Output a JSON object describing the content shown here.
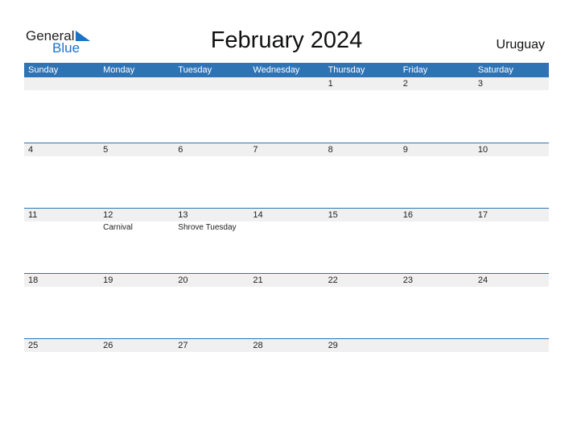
{
  "logo": {
    "word1": "General",
    "word2": "Blue"
  },
  "title": "February 2024",
  "country": "Uruguay",
  "weekdays": [
    "Sunday",
    "Monday",
    "Tuesday",
    "Wednesday",
    "Thursday",
    "Friday",
    "Saturday"
  ],
  "weeks": [
    [
      {
        "d": ""
      },
      {
        "d": ""
      },
      {
        "d": ""
      },
      {
        "d": ""
      },
      {
        "d": "1"
      },
      {
        "d": "2"
      },
      {
        "d": "3"
      }
    ],
    [
      {
        "d": "4"
      },
      {
        "d": "5"
      },
      {
        "d": "6"
      },
      {
        "d": "7"
      },
      {
        "d": "8"
      },
      {
        "d": "9"
      },
      {
        "d": "10"
      }
    ],
    [
      {
        "d": "11"
      },
      {
        "d": "12",
        "h": "Carnival"
      },
      {
        "d": "13",
        "h": "Shrove Tuesday"
      },
      {
        "d": "14"
      },
      {
        "d": "15"
      },
      {
        "d": "16"
      },
      {
        "d": "17"
      }
    ],
    [
      {
        "d": "18"
      },
      {
        "d": "19"
      },
      {
        "d": "20"
      },
      {
        "d": "21"
      },
      {
        "d": "22"
      },
      {
        "d": "23"
      },
      {
        "d": "24"
      }
    ],
    [
      {
        "d": "25"
      },
      {
        "d": "26"
      },
      {
        "d": "27"
      },
      {
        "d": "28"
      },
      {
        "d": "29"
      },
      {
        "d": ""
      },
      {
        "d": ""
      }
    ]
  ],
  "colors": {
    "accent": "#2e74b5",
    "strip": "#f0f0f0",
    "logo_blue": "#1a73c8"
  }
}
